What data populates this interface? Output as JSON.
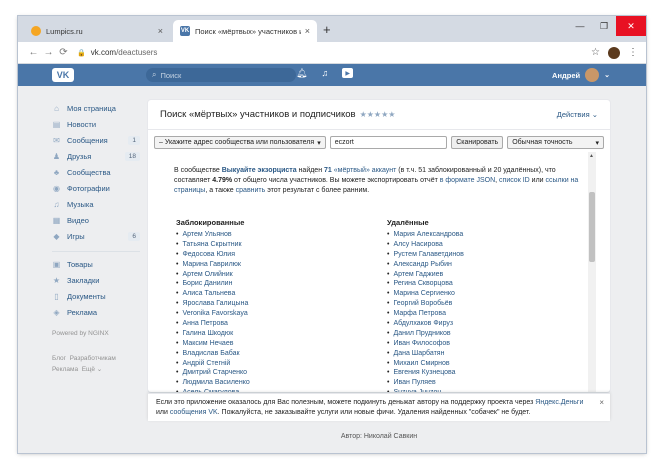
{
  "browser": {
    "tabs": [
      {
        "title": "Lumpics.ru",
        "close": "×"
      },
      {
        "title": "Поиск «мёртвых» участников и п",
        "close": "×"
      }
    ],
    "new_tab": "+",
    "url_domain": "vk.com",
    "url_path": "/deactusers",
    "window_controls": {
      "minimize": "—",
      "maximize": "❐",
      "close": "✕"
    },
    "nav": {
      "back": "←",
      "forward": "→",
      "reload": "⟳"
    },
    "lock_icon": "🔒",
    "star_icon": "☆",
    "menu_icon": "⋮"
  },
  "vk": {
    "logo": "VK",
    "search_placeholder": "Поиск",
    "user_name": "Андрей",
    "colors": {
      "header": "#4a76a8",
      "link": "#2a5885",
      "background": "#edeef0"
    }
  },
  "menu": {
    "items": [
      {
        "label": "Моя страница",
        "icon": "home-icon",
        "glyph": "⌂",
        "count": ""
      },
      {
        "label": "Новости",
        "icon": "news-icon",
        "glyph": "▤",
        "count": ""
      },
      {
        "label": "Сообщения",
        "icon": "messages-icon",
        "glyph": "✉",
        "count": "1"
      },
      {
        "label": "Друзья",
        "icon": "friends-icon",
        "glyph": "♟",
        "count": "18"
      },
      {
        "label": "Сообщества",
        "icon": "groups-icon",
        "glyph": "♣",
        "count": ""
      },
      {
        "label": "Фотографии",
        "icon": "photos-icon",
        "glyph": "◉",
        "count": ""
      },
      {
        "label": "Музыка",
        "icon": "music-icon",
        "glyph": "♫",
        "count": ""
      },
      {
        "label": "Видео",
        "icon": "video-icon",
        "glyph": "▦",
        "count": ""
      },
      {
        "label": "Игры",
        "icon": "games-icon",
        "glyph": "◆",
        "count": "6"
      }
    ],
    "items2": [
      {
        "label": "Товары",
        "icon": "market-icon",
        "glyph": "▣"
      },
      {
        "label": "Закладки",
        "icon": "bookmarks-icon",
        "glyph": "★"
      },
      {
        "label": "Документы",
        "icon": "documents-icon",
        "glyph": "▯"
      },
      {
        "label": "Реклама",
        "icon": "ads-icon",
        "glyph": "◈"
      }
    ],
    "powered": "Powered by NGINX",
    "footer": [
      "Блог",
      "Разработчикам",
      "Реклама",
      "Ещё ⌄"
    ]
  },
  "card": {
    "title": "Поиск «мёртвых» участников и подписчиков",
    "stars": "★★★★★",
    "actions": "Действия ⌄",
    "select_label": "– Укажите адрес сообщества или пользователя",
    "input_value": "eczort",
    "scan_button": "Сканировать",
    "precision": "Обычная точность",
    "summary": {
      "p1": "В сообществе ",
      "group": "Выкуайте экзорциста",
      "p2": " найден ",
      "count": "71",
      "p3": " «мёртвый» аккаунт",
      "p4": " (в т.ч. 51 заблокированный и 20 удалённых), что составляет ",
      "percent": "4.79%",
      "p5": " от общего числа участников. Вы можете экспортировать отчёт ",
      "json": "в формате JSON",
      "sep1": ", ",
      "ids": "список ID",
      "sep2": " или ",
      "links": "ссылки на страницы",
      "p6": ", а также ",
      "compare": "сравнить",
      "p7": " этот результат с более ранним."
    },
    "blocked_title": "Заблокированные",
    "blocked": [
      "Артем Ульянов",
      "Татьяна Скрытник",
      "Федосова Юлия",
      "Марина Гаврилюк",
      "Артем Олийник",
      "Борис Данилин",
      "Алиса Тальнева",
      "Ярослава Галицына",
      "Veronika Favorskaya",
      "Анна Петрова",
      "Галина Шкодюк",
      "Максим Нечаев",
      "Владислав Бабак",
      "Андрій Стегній",
      "Дмитрий Старченко",
      "Людмила Василенко",
      "Асель Смагулова",
      "Алиса Алексеева",
      "Viktor Kovshov",
      "Максим Новиков"
    ],
    "deleted_title": "Удалённые",
    "deleted": [
      "Мария Александрова",
      "Алсу Насирова",
      "Рустем Галаветдинов",
      "Александр Рыбин",
      "Артем Гаджиев",
      "Регина Скворцова",
      "Марина Сергиенко",
      "Георгий Воробьёв",
      "Марфа Петрова",
      "Абдулхаков Фируз",
      "Данил Прудников",
      "Иван Философов",
      "Дана Шарбатян",
      "Михаил Смирнов",
      "Евгения Кузнецова",
      "Иван Пуляев",
      "Suzuya Juuzou",
      "Илья Местный",
      "Юрий Павлов",
      "Денис Иванов"
    ]
  },
  "notice": {
    "p1": "Если это приложение оказалось для Вас полезным, можете подкинуть деньжат автору на поддержку проекта через ",
    "yandex": "Яндекс.Деньги",
    "p2": " или ",
    "vkmsg": "сообщения VK",
    "p3": ". Пожалуйста, не заказывайте услуги или новые фичи. Удаления найденных \"собачек\" не будет.",
    "close": "×"
  },
  "author": "Автор: Николай Савкин"
}
